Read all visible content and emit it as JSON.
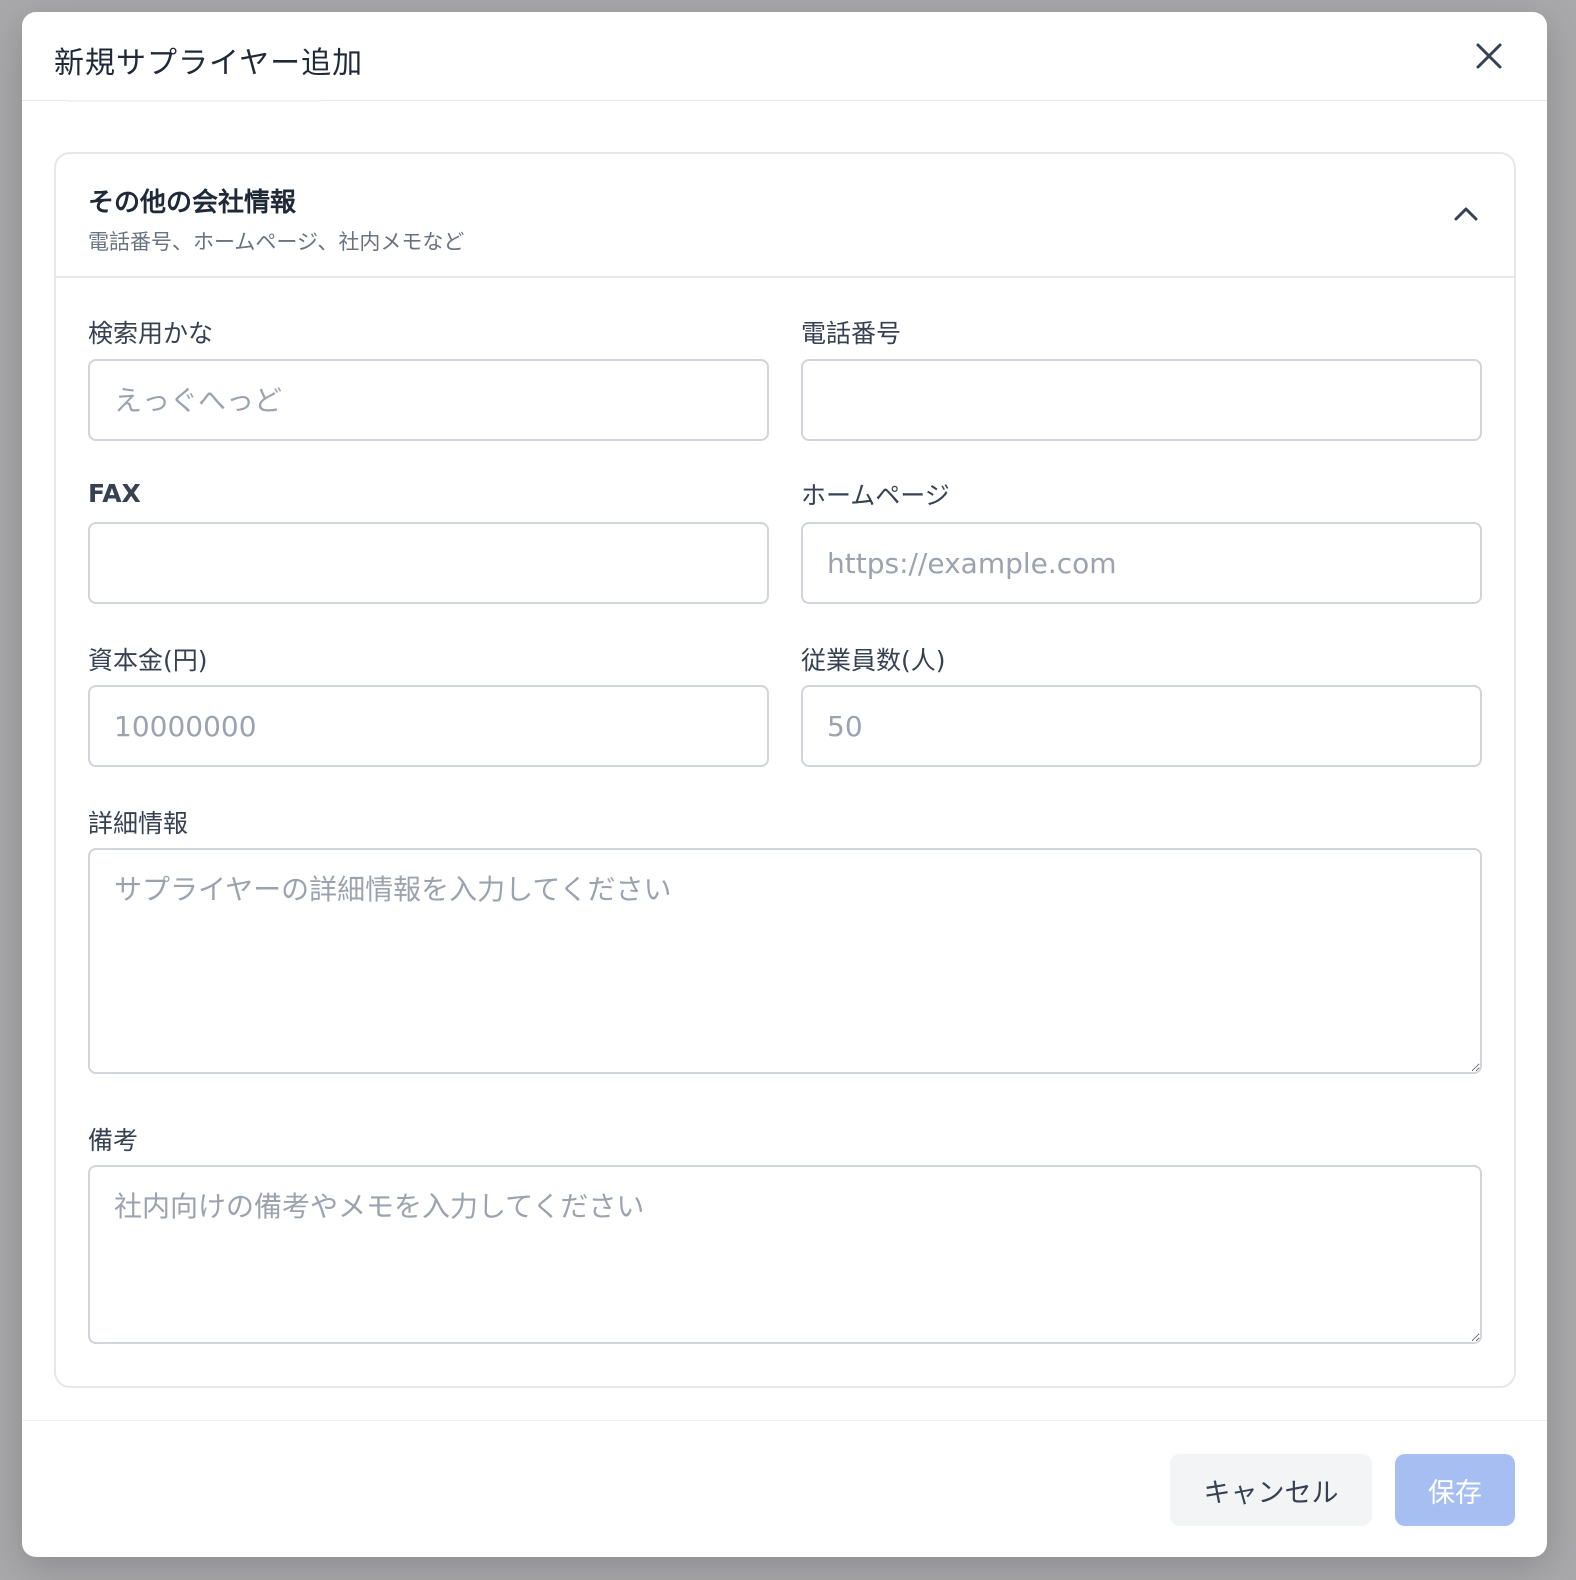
{
  "modal": {
    "title": "新規サプライヤー追加",
    "close_icon": "close-icon"
  },
  "section": {
    "title": "その他の会社情報",
    "subtitle": "電話番号、ホームページ、社内メモなど",
    "toggle_icon": "chevron-up-icon"
  },
  "fields": {
    "search_kana": {
      "label": "検索用かな",
      "value": "",
      "placeholder": "えっぐへっど"
    },
    "phone": {
      "label": "電話番号",
      "value": "",
      "placeholder": ""
    },
    "fax": {
      "label": "FAX",
      "value": "",
      "placeholder": ""
    },
    "homepage": {
      "label": "ホームページ",
      "value": "",
      "placeholder": "https://example.com"
    },
    "capital": {
      "label": "資本金(円)",
      "value": "",
      "placeholder": "10000000"
    },
    "employees": {
      "label": "従業員数(人)",
      "value": "",
      "placeholder": "50"
    },
    "details": {
      "label": "詳細情報",
      "value": "",
      "placeholder": "サプライヤーの詳細情報を入力してください"
    },
    "notes": {
      "label": "備考",
      "value": "",
      "placeholder": "社内向けの備考やメモを入力してください"
    }
  },
  "footer": {
    "cancel_label": "キャンセル",
    "save_label": "保存"
  },
  "colors": {
    "save_button_disabled": "#a6bef2",
    "cancel_button": "#f3f4f6",
    "border": "#d1d5db",
    "placeholder": "#9ca3af"
  }
}
